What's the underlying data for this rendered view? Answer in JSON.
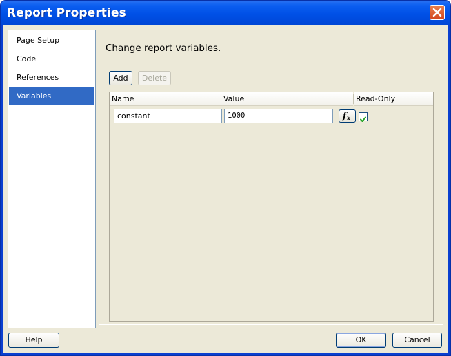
{
  "window": {
    "title": "Report Properties"
  },
  "sidebar": {
    "items": [
      {
        "label": "Page Setup"
      },
      {
        "label": "Code"
      },
      {
        "label": "References"
      },
      {
        "label": "Variables"
      }
    ],
    "selected": "Variables"
  },
  "content": {
    "heading": "Change report variables.",
    "add_label": "Add",
    "delete_label": "Delete"
  },
  "grid": {
    "columns": [
      "Name",
      "Value",
      "Read-Only"
    ],
    "rows": [
      {
        "name": "constant",
        "value": "1000",
        "expression_button": "fx",
        "read_only": true
      }
    ]
  },
  "footer": {
    "help_label": "Help",
    "ok_label": "OK",
    "cancel_label": "Cancel"
  },
  "colors": {
    "titlebar": "#0050e6",
    "selection": "#316ac5",
    "dialog_bg": "#ece9d8",
    "close_button": "#d2461e",
    "checkmark": "#21a121"
  },
  "icons": {
    "close": "close-icon",
    "expression": "function-icon",
    "check": "checkmark-icon"
  }
}
